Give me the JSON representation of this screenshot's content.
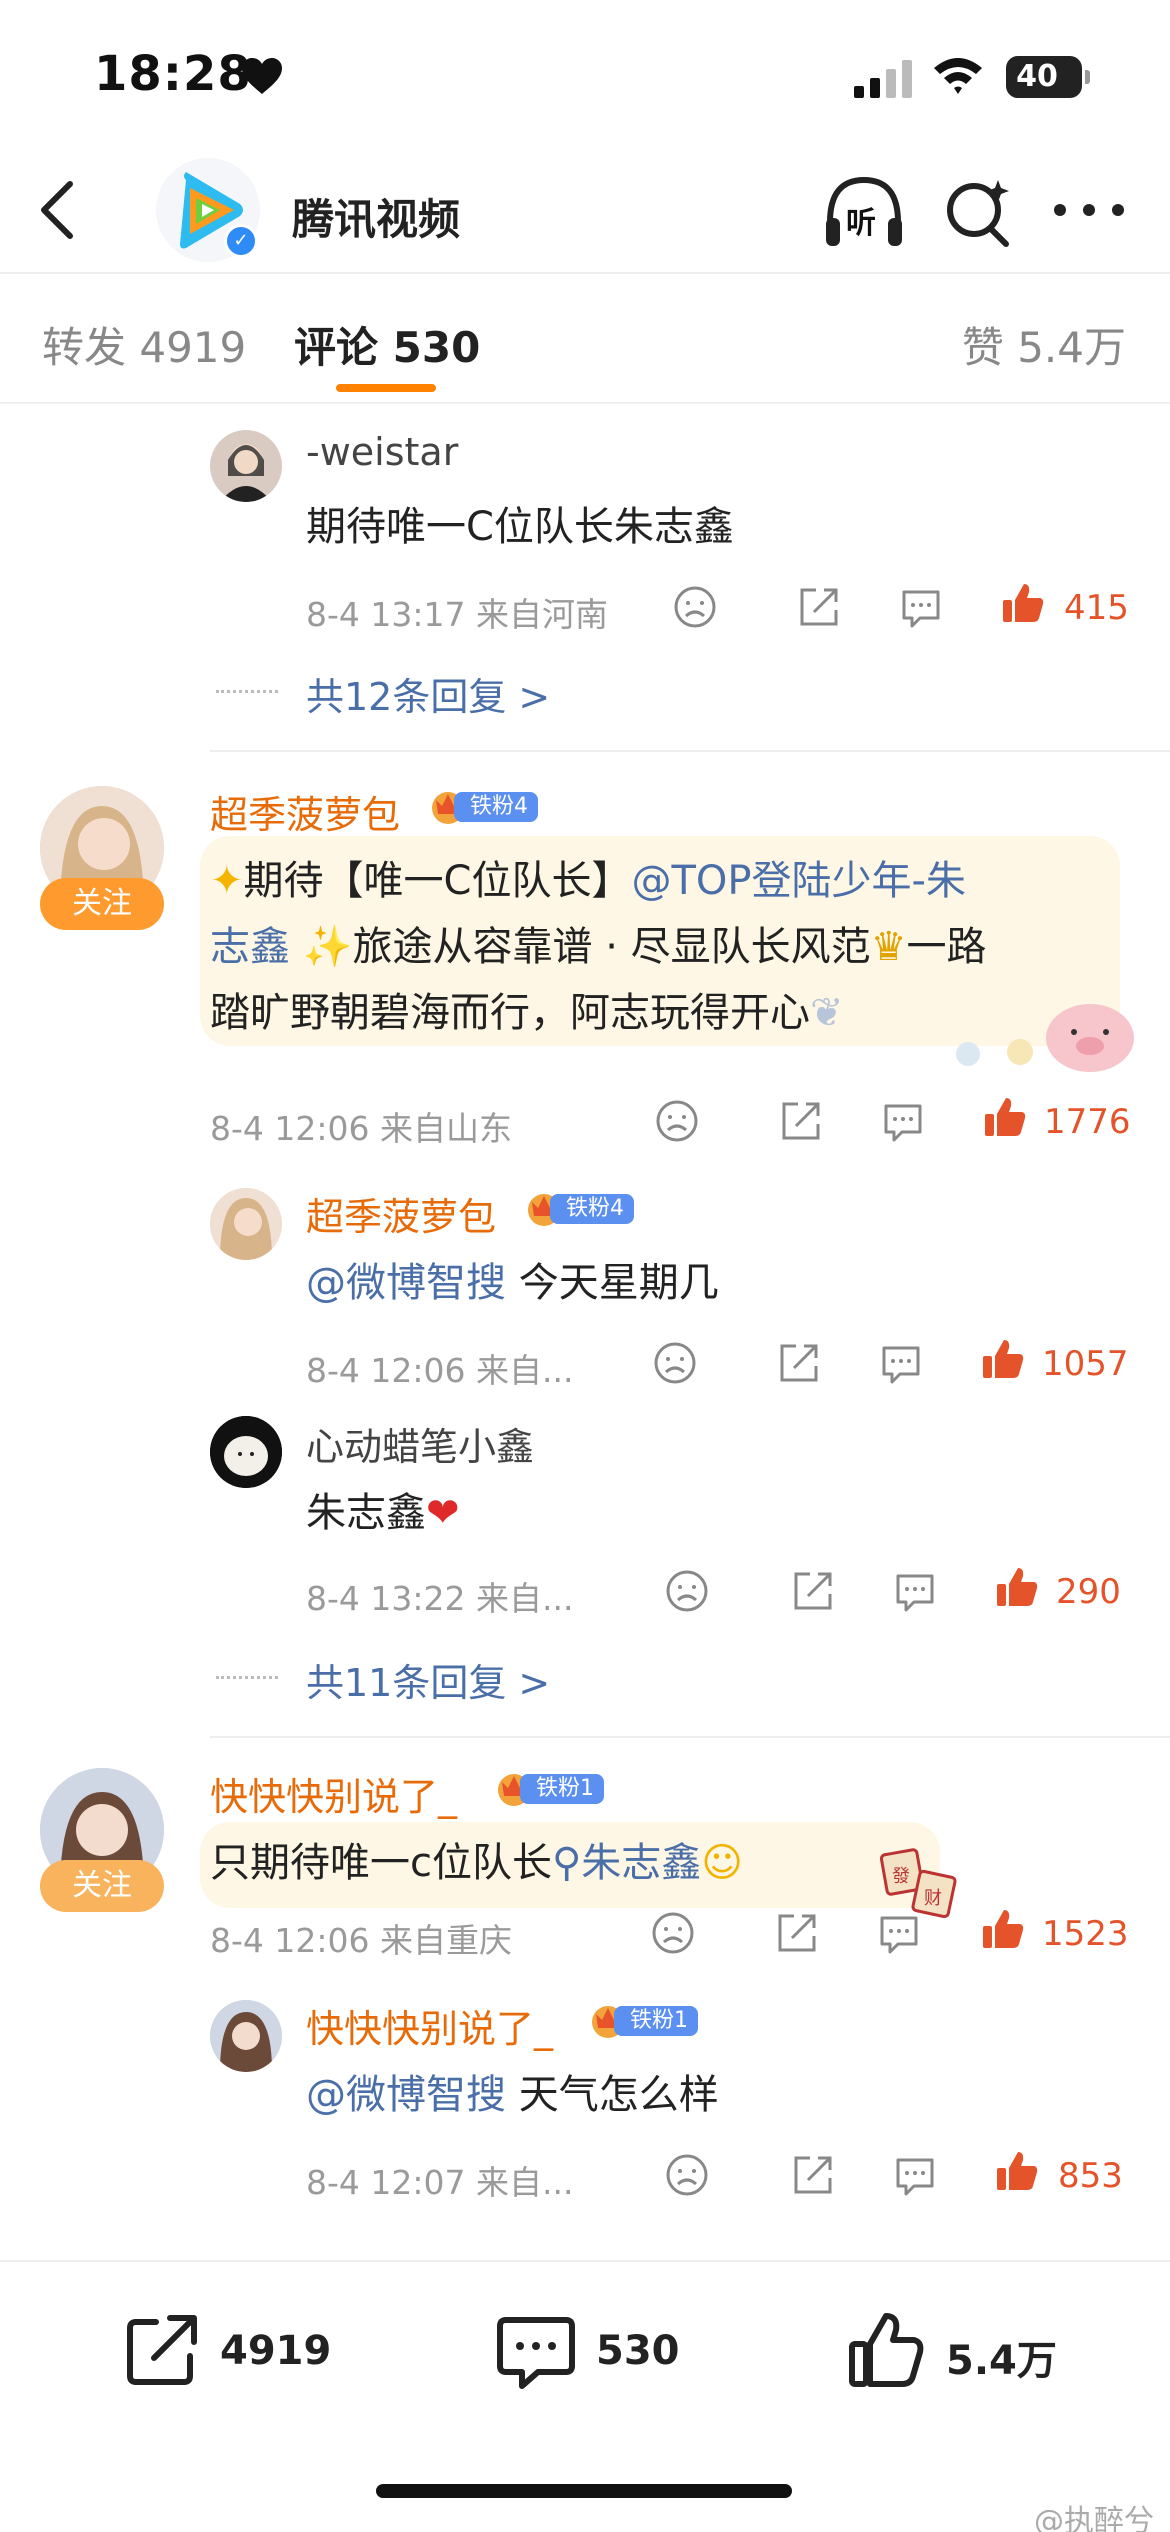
{
  "status_bar": {
    "time": "18:28",
    "battery": "40"
  },
  "nav": {
    "title": "腾讯视频",
    "listen_label": "听"
  },
  "tabs": {
    "repost": "转发 4919",
    "comment": "评论 530",
    "like": "赞 5.4万"
  },
  "comments": [
    {
      "reply1": {
        "name": "-weistar",
        "text": "期待唯一C位队长朱志鑫",
        "meta": "8-4 13:17 来自河南",
        "likes": "415"
      },
      "more_replies": "共12条回复 >"
    },
    {
      "name": "超季菠萝包",
      "badge": "铁粉4",
      "follow": "关注",
      "text_parts": [
        "期待【唯一C位队长】",
        "@TOP登陆少年-朱",
        "志鑫",
        "旅途从容靠谱 · 尽显队长风范",
        "一路",
        "踏旷野朝碧海而行，阿志玩得开心"
      ],
      "meta": "8-4 12:06 来自山东",
      "likes": "1776",
      "replies": [
        {
          "name": "超季菠萝包",
          "badge": "铁粉4",
          "mention": "@微博智搜",
          "text": " 今天星期几",
          "meta": "8-4 12:06 来自...",
          "likes": "1057"
        },
        {
          "name": "心动蜡笔小鑫",
          "text": "朱志鑫",
          "meta": "8-4 13:22 来自...",
          "likes": "290"
        }
      ],
      "more_replies": "共11条回复 >"
    },
    {
      "name": "快快快别说了_",
      "badge": "铁粉1",
      "follow": "关注",
      "text_before": "只期待唯一c位队长",
      "search_link": "朱志鑫",
      "meta": "8-4 12:06 来自重庆",
      "likes": "1523",
      "replies": [
        {
          "name": "快快快别说了_",
          "badge": "铁粉1",
          "mention": "@微博智搜",
          "text": " 天气怎么样",
          "meta": "8-4 12:07 来自...",
          "likes": "853"
        }
      ]
    }
  ],
  "bottom_bar": {
    "repost": "4919",
    "comment": "530",
    "like": "5.4万"
  },
  "watermark": "@执醉兮",
  "colors": {
    "accent": "#ff8200",
    "username": "#e86b0a",
    "link": "#4a6fa8",
    "like": "#e4532a"
  }
}
